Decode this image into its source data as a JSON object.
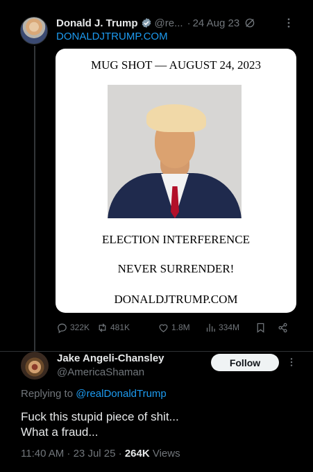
{
  "post": {
    "author_name": "Donald J. Trump",
    "author_handle": "@re...",
    "date": "24 Aug 23",
    "link_text": "DONALDJTRUMP.COM",
    "card": {
      "title": "MUG SHOT — AUGUST 24, 2023",
      "line1": "ELECTION INTERFERENCE",
      "line2": "NEVER SURRENDER!",
      "line3": "DONALDJTRUMP.COM"
    },
    "stats": {
      "replies": "322K",
      "reposts": "481K",
      "likes": "1.8M",
      "views": "334M"
    }
  },
  "reply": {
    "author_name": "Jake Angeli-Chansley",
    "author_handle": "@AmericaShaman",
    "follow_label": "Follow",
    "replying_prefix": "Replying to",
    "replying_to": "@realDonaldTrump",
    "text_line1": "Fuck this stupid piece of shit...",
    "text_line2": "What a fraud...",
    "time": "11:40 AM · 23 Jul 25 ·",
    "views_count": "264K",
    "views_label": "Views"
  },
  "colors": {
    "background": "#000000",
    "link": "#1d9bf0",
    "muted": "#71767b",
    "text": "#e7e9ea",
    "verified_badge": "#829aab"
  },
  "icons": [
    "verified-badge-icon",
    "edit-slash-icon",
    "more-icon",
    "reply-icon",
    "repost-icon",
    "like-icon",
    "views-icon",
    "bookmark-icon",
    "share-icon"
  ]
}
